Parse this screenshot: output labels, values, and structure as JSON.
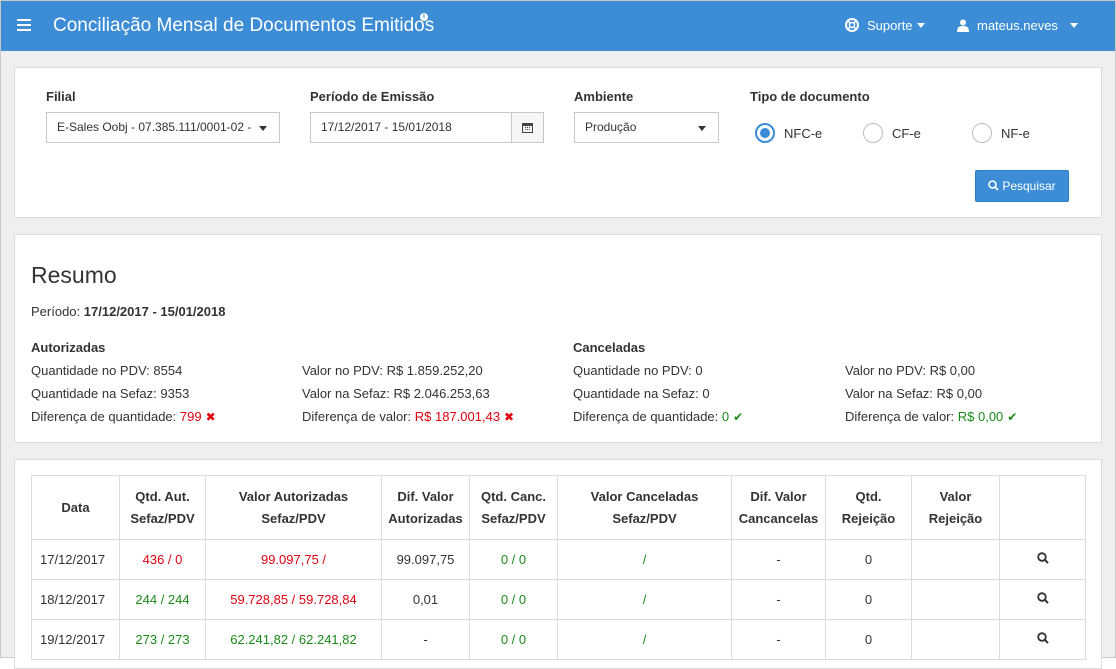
{
  "header": {
    "title": "Conciliação Mensal de Documentos Emitidos",
    "info_icon": "info-icon",
    "support_label": "Suporte",
    "user_label": "mateus.neves",
    "brand_color": "#3c8dd6"
  },
  "filters": {
    "filial_label": "Filial",
    "filial_value": "E-Sales Oobj - 07.385.111/0001-02 -",
    "periodo_label": "Período de Emissão",
    "periodo_value": "17/12/2017 - 15/01/2018",
    "ambiente_label": "Ambiente",
    "ambiente_value": "Produção",
    "tipo_label": "Tipo de documento",
    "tipos": [
      {
        "label": "NFC-e",
        "checked": true
      },
      {
        "label": "CF-e",
        "checked": false
      },
      {
        "label": "NF-e",
        "checked": false
      }
    ],
    "search_label": "Pesquisar"
  },
  "summary": {
    "title": "Resumo",
    "periodo_label": "Período:",
    "periodo_value": "17/12/2017 - 15/01/2018",
    "autorizadas": {
      "heading": "Autorizadas",
      "qtd_pdv_label": "Quantidade no PDV:",
      "qtd_pdv": "8554",
      "qtd_sefaz_label": "Quantidade na Sefaz:",
      "qtd_sefaz": "9353",
      "dif_qtd_label": "Diferença de quantidade:",
      "dif_qtd": "799",
      "valor_pdv_label": "Valor no PDV:",
      "valor_pdv": "R$ 1.859.252,20",
      "valor_sefaz_label": "Valor na Sefaz:",
      "valor_sefaz": "R$ 2.046.253,63",
      "dif_valor_label": "Diferença de valor:",
      "dif_valor": "R$ 187.001,43"
    },
    "canceladas": {
      "heading": "Canceladas",
      "qtd_pdv_label": "Quantidade no PDV:",
      "qtd_pdv": "0",
      "qtd_sefaz_label": "Quantidade na Sefaz:",
      "qtd_sefaz": "0",
      "dif_qtd_label": "Diferença de quantidade:",
      "dif_qtd": "0",
      "valor_pdv_label": "Valor no PDV:",
      "valor_pdv": "R$ 0,00",
      "valor_sefaz_label": "Valor na Sefaz:",
      "valor_sefaz": "R$ 0,00",
      "dif_valor_label": "Diferença de valor:",
      "dif_valor": "R$ 0,00"
    }
  },
  "table": {
    "headers": [
      [
        "Data"
      ],
      [
        "Qtd. Aut.",
        "Sefaz/PDV"
      ],
      [
        "Valor Autorizadas",
        "Sefaz/PDV"
      ],
      [
        "Dif. Valor",
        "Autorizadas"
      ],
      [
        "Qtd. Canc.",
        "Sefaz/PDV"
      ],
      [
        "Valor Canceladas",
        "Sefaz/PDV"
      ],
      [
        "Dif. Valor",
        "Cancancelas"
      ],
      [
        "Qtd.",
        "Rejeição"
      ],
      [
        "Valor",
        "Rejeição"
      ],
      [
        ""
      ]
    ],
    "rows": [
      {
        "data": "17/12/2017",
        "qtd_aut": "436 / 0",
        "qtd_aut_color": "red",
        "valor_aut": "99.097,75 /",
        "valor_aut_color": "red",
        "dif_aut": "99.097,75",
        "qtd_canc": "0 / 0",
        "valor_canc": "/",
        "dif_canc": "-",
        "qtd_rej": "0",
        "valor_rej": ""
      },
      {
        "data": "18/12/2017",
        "qtd_aut": "244 / 244",
        "qtd_aut_color": "green",
        "valor_aut": "59.728,85 / 59.728,84",
        "valor_aut_color": "red",
        "dif_aut": "0,01",
        "qtd_canc": "0 / 0",
        "valor_canc": "/",
        "dif_canc": "-",
        "qtd_rej": "0",
        "valor_rej": ""
      },
      {
        "data": "19/12/2017",
        "qtd_aut": "273 / 273",
        "qtd_aut_color": "green",
        "valor_aut": "62.241,82 / 62.241,82",
        "valor_aut_color": "green",
        "dif_aut": "-",
        "qtd_canc": "0 / 0",
        "valor_canc": "/",
        "dif_canc": "-",
        "qtd_rej": "0",
        "valor_rej": ""
      }
    ]
  }
}
